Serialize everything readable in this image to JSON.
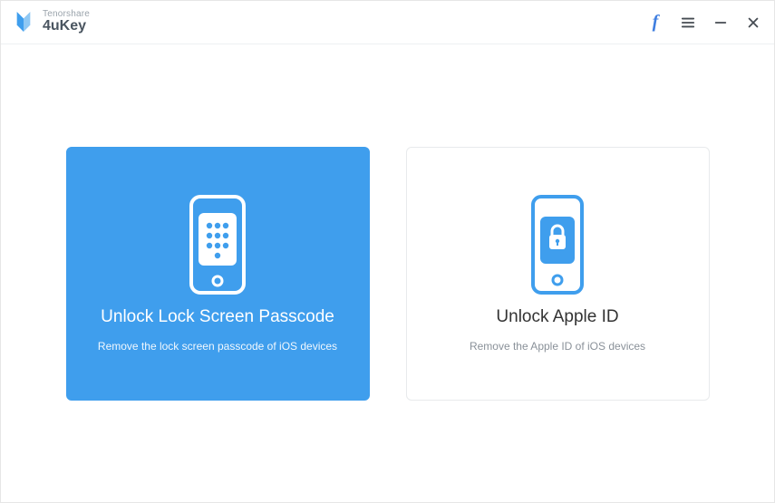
{
  "brand": {
    "company": "Tenorshare",
    "product": "4uKey"
  },
  "titlebar": {
    "facebook": "f"
  },
  "cards": {
    "unlockPasscode": {
      "title": "Unlock Lock Screen Passcode",
      "subtitle": "Remove the lock screen passcode of iOS devices"
    },
    "unlockAppleId": {
      "title": "Unlock Apple ID",
      "subtitle": "Remove the Apple ID of iOS devices"
    }
  },
  "colors": {
    "accent": "#3f9eed",
    "facebook": "#3f7ee0"
  }
}
